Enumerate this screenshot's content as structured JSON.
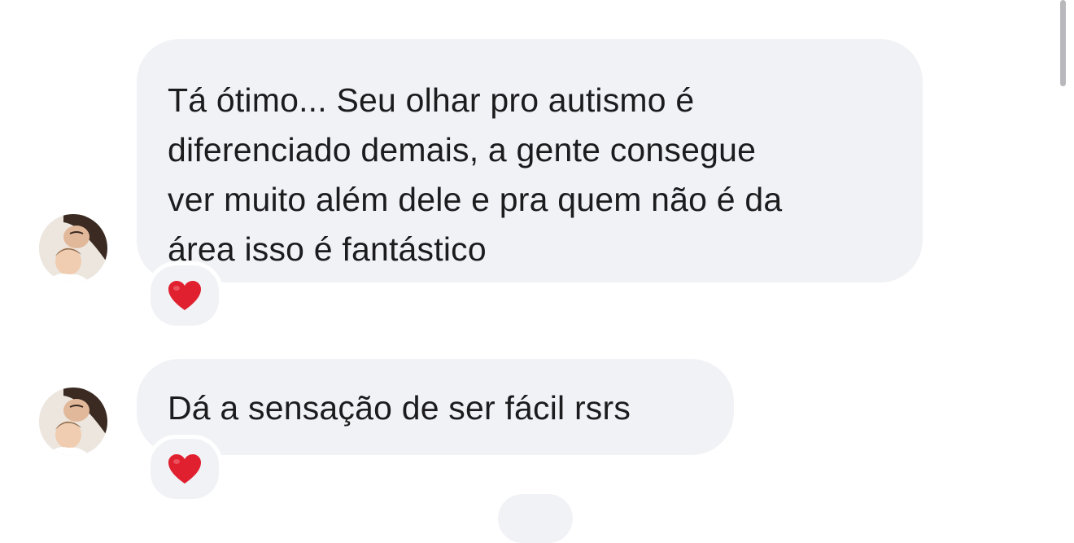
{
  "thread": {
    "messages": [
      {
        "lines": [
          "Tá ótimo... Seu olhar pro autismo é",
          "diferenciado demais, a gente consegue",
          "ver muito além dele e pra quem não é da",
          "área isso é fantástico"
        ],
        "reaction": "red-heart"
      },
      {
        "lines": [
          "Dá a sensação de ser fácil rsrs"
        ],
        "reaction": "red-heart"
      }
    ]
  },
  "colors": {
    "bubble": "#f1f2f6",
    "text": "#1c1c1e",
    "heart": "#e0202f",
    "background": "#ffffff"
  }
}
